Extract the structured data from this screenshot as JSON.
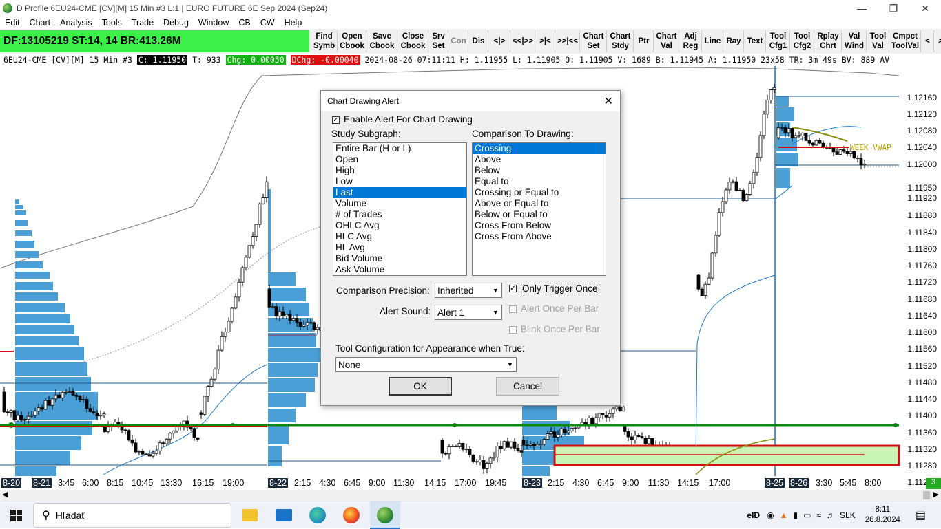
{
  "window": {
    "title": "D Profile 6EU24-CME [CV][M]  15 Min  #3 L:1 | EURO FUTURE 6E Sep 2024 (Sep24)"
  },
  "menu": [
    "Edit",
    "Chart",
    "Analysis",
    "Tools",
    "Trade",
    "Debug",
    "Window",
    "CB",
    "CW",
    "Help"
  ],
  "dfbox": "DF:13105219  ST:14, 14  BR:413.26M",
  "toolbar": [
    {
      "l1": "Find",
      "l2": "Symb"
    },
    {
      "l1": "Open",
      "l2": "Cbook"
    },
    {
      "l1": "Save",
      "l2": "Cbook"
    },
    {
      "l1": "Close",
      "l2": "Cbook"
    },
    {
      "l1": "Srv",
      "l2": "Set"
    },
    {
      "l1": "Con",
      "l2": "",
      "disabled": true
    },
    {
      "l1": "Dis",
      "l2": ""
    },
    {
      "l1": "<|>",
      "l2": ""
    },
    {
      "l1": "<<|>>",
      "l2": ""
    },
    {
      "l1": ">|<",
      "l2": ""
    },
    {
      "l1": ">>|<<",
      "l2": ""
    },
    {
      "l1": "Chart",
      "l2": "Set"
    },
    {
      "l1": "Chart",
      "l2": "Stdy"
    },
    {
      "l1": "Ptr",
      "l2": ""
    },
    {
      "l1": "Chart",
      "l2": "Val"
    },
    {
      "l1": "Adj",
      "l2": "Reg"
    },
    {
      "l1": "Line",
      "l2": ""
    },
    {
      "l1": "Ray",
      "l2": ""
    },
    {
      "l1": "Text",
      "l2": ""
    },
    {
      "l1": "Tool",
      "l2": "Cfg1"
    },
    {
      "l1": "Tool",
      "l2": "Cfg2"
    },
    {
      "l1": "Rplay",
      "l2": "Chrt"
    },
    {
      "l1": "Val",
      "l2": "Wind"
    },
    {
      "l1": "Tool",
      "l2": "Val"
    },
    {
      "l1": "Cmpct",
      "l2": "ToolVal"
    },
    {
      "l1": "<",
      "l2": ""
    },
    {
      "l1": ">",
      "l2": ""
    }
  ],
  "status": {
    "symbol": "6EU24-CME [CV][M]  15 Min  #3",
    "close": "C: 1.11950",
    "trades": "T: 933",
    "chg": "Chg: 0.00050",
    "dchg": "DChg: -0.00040",
    "rest": "2024-08-26 07:11:11 H: 1.11955 L: 1.11905 O: 1.11905 V: 1689 B: 1.11945 A: 1.11950 23x58 TR: 3m 49s BV: 889 AV"
  },
  "price_scale": [
    "1.12160",
    "1.12120",
    "1.12080",
    "1.12040",
    "1.12000",
    "1.11950",
    "1.11920",
    "1.11880",
    "1.11840",
    "1.11800",
    "1.11760",
    "1.11720",
    "1.11680",
    "1.11640",
    "1.11600",
    "1.11560",
    "1.11520",
    "1.11480",
    "1.11440",
    "1.11400",
    "1.11360",
    "1.11320",
    "1.11280",
    "1.11240"
  ],
  "week_vwap": "WEEK VWAP",
  "time_axis": [
    {
      "t": "8-20",
      "dt": true
    },
    {
      "t": "8-21",
      "dt": true
    },
    {
      "t": "3:45"
    },
    {
      "t": "6:00"
    },
    {
      "t": "8:15"
    },
    {
      "t": "10:45"
    },
    {
      "t": "13:30"
    },
    {
      "t": "16:15"
    },
    {
      "t": "19:00"
    },
    {
      "t": "8-22",
      "dt": true
    },
    {
      "t": "2:15"
    },
    {
      "t": "4:30"
    },
    {
      "t": "6:45"
    },
    {
      "t": "9:00"
    },
    {
      "t": "11:30"
    },
    {
      "t": "14:15"
    },
    {
      "t": "17:00"
    },
    {
      "t": "19:45"
    },
    {
      "t": "8-23",
      "dt": true
    },
    {
      "t": "2:15"
    },
    {
      "t": "4:30"
    },
    {
      "t": "6:45"
    },
    {
      "t": "9:00"
    },
    {
      "t": "11:30"
    },
    {
      "t": "14:15"
    },
    {
      "t": "17:00"
    },
    {
      "t": "8-25",
      "dt": true
    },
    {
      "t": "8-26",
      "dt": true
    },
    {
      "t": "3:30"
    },
    {
      "t": "5:45"
    },
    {
      "t": "8:00"
    }
  ],
  "corner_badge": "3",
  "dialog": {
    "title": "Chart Drawing Alert",
    "enable_label": "Enable Alert For Chart Drawing",
    "enable_checked": true,
    "study_subgraph_label": "Study Subgraph:",
    "study_subgraph_items": [
      "Entire Bar (H or L)",
      "Open",
      "High",
      "Low",
      "Last",
      "Volume",
      "# of Trades",
      "OHLC Avg",
      "HLC Avg",
      "HL Avg",
      "Bid Volume",
      "Ask Volume"
    ],
    "study_subgraph_selected": "Last",
    "comparison_label": "Comparison To Drawing:",
    "comparison_items": [
      "Crossing",
      "Above",
      "Below",
      "Equal to",
      "Crossing or Equal to",
      "Above or Equal to",
      "Below or Equal to",
      "Cross From Below",
      "Cross From Above"
    ],
    "comparison_selected": "Crossing",
    "precision_label": "Comparison Precision:",
    "precision_value": "Inherited",
    "sound_label": "Alert Sound:",
    "sound_value": "Alert 1",
    "only_once_label": "Only Trigger Once",
    "only_once_checked": true,
    "alert_once_per_bar_label": "Alert Once Per Bar",
    "blink_once_label": "Blink Once Per Bar",
    "tool_config_label": "Tool Configuration for Appearance when True:",
    "tool_config_value": "None",
    "ok_label": "OK",
    "cancel_label": "Cancel"
  },
  "taskbar": {
    "search_placeholder": "Hľadať",
    "lang": "SLK",
    "time": "8:11",
    "date": "26.8.2024"
  }
}
